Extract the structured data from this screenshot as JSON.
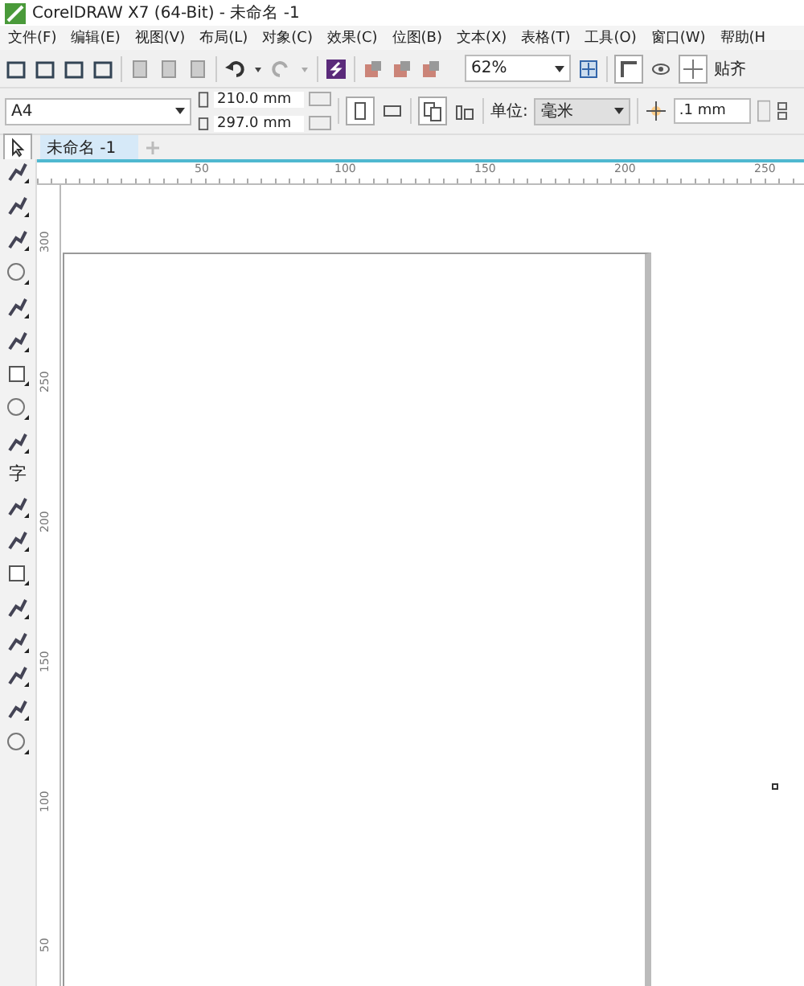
{
  "window": {
    "title": "CorelDRAW X7 (64-Bit) - 未命名 -1"
  },
  "menu": [
    "文件(F)",
    "编辑(E)",
    "视图(V)",
    "布局(L)",
    "对象(C)",
    "效果(C)",
    "位图(B)",
    "文本(X)",
    "表格(T)",
    "工具(O)",
    "窗口(W)",
    "帮助(H"
  ],
  "toolbar": {
    "zoom": "62%",
    "snap_label": "贴齐"
  },
  "property_bar": {
    "page_size": "A4",
    "width": "210.0 mm",
    "height": "297.0 mm",
    "units_label": "单位:",
    "units": "毫米",
    "nudge": ".1 mm"
  },
  "tabs": [
    {
      "label": "未命名 -1",
      "selected": true
    }
  ],
  "text_tool": "字",
  "rulers": {
    "horizontal": [
      "50",
      "100",
      "150",
      "200",
      "250"
    ],
    "vertical": [
      "300",
      "250",
      "200",
      "150",
      "100",
      "50"
    ]
  }
}
